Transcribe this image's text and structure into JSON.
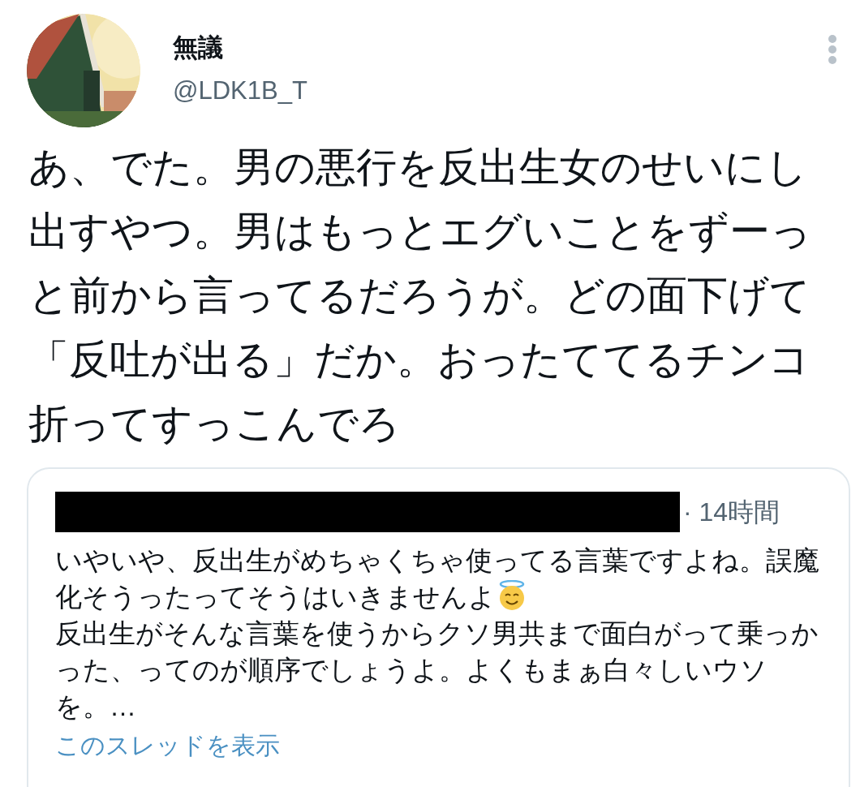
{
  "author": {
    "name": "無議",
    "handle": "@LDK1B_T"
  },
  "tweet_text": "あ、でた。男の悪行を反出生女のせいにし出すやつ。男はもっとエグいことをずーっと前から言ってるだろうが。どの面下げて「反吐が出る」だか。おったててるチンコ折ってすっこんでろ",
  "quoted_tweet": {
    "author_redacted": true,
    "time": "· 14時間",
    "paragraphs": [
      {
        "text": "いやいや、反出生がめちゃくちゃ使ってる言葉ですよね。誤魔化そうったってそうはいきませんよ",
        "halo_emoji": true
      },
      {
        "text": "反出生がそんな言葉を使うからクソ男共まで面白がって乗っかった、ってのが順序でしょうよ。よくもまぁ白々しいウソを。…"
      }
    ],
    "show_thread_link": "このスレッドを表示"
  }
}
